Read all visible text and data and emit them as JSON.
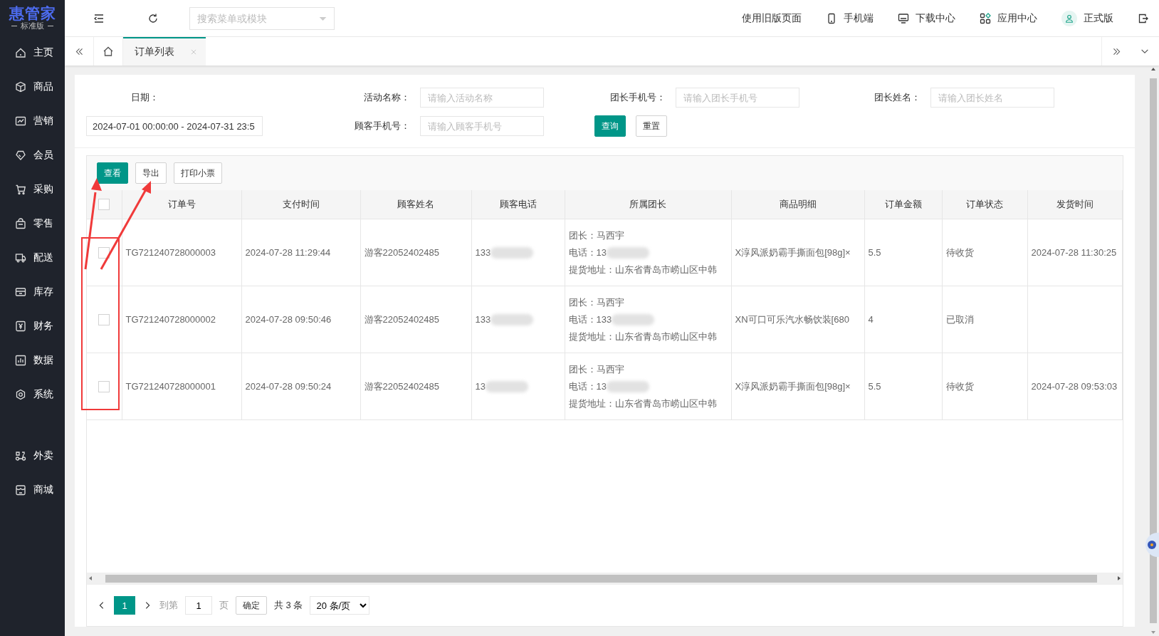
{
  "logo": {
    "title": "惠管家",
    "subtitle": "标准版"
  },
  "sidebar": {
    "items": [
      {
        "label": "主页"
      },
      {
        "label": "商品"
      },
      {
        "label": "营销"
      },
      {
        "label": "会员"
      },
      {
        "label": "采购"
      },
      {
        "label": "零售"
      },
      {
        "label": "配送"
      },
      {
        "label": "库存"
      },
      {
        "label": "财务"
      },
      {
        "label": "数据"
      },
      {
        "label": "系统"
      }
    ],
    "extra_items": [
      {
        "label": "外卖"
      },
      {
        "label": "商城"
      }
    ]
  },
  "topbar": {
    "search": {
      "placeholder": "搜索菜单或模块"
    },
    "links": [
      {
        "label": "使用旧版页面",
        "kind": "text"
      },
      {
        "label": "手机端",
        "kind": "phone"
      },
      {
        "label": "下载中心",
        "kind": "monitor"
      },
      {
        "label": "应用中心",
        "kind": "apps"
      },
      {
        "label": "正式版",
        "kind": "user"
      }
    ]
  },
  "tabs": [
    {
      "label": "订单列表",
      "selected": true
    }
  ],
  "filters": {
    "date_label": "日期：",
    "date_value": "2024-07-01 00:00:00 - 2024-07-31 23:5",
    "fields": [
      {
        "label": "活动名称：",
        "placeholder": "请输入活动名称"
      },
      {
        "label": "团长手机号：",
        "placeholder": "请输入团长手机号"
      },
      {
        "label": "团长姓名：",
        "placeholder": "请输入团长姓名"
      },
      {
        "label": "顾客手机号：",
        "placeholder": "请输入顾客手机号"
      }
    ],
    "query_button": "查询",
    "reset_button": "重置"
  },
  "toolbar": [
    {
      "label": "查看",
      "primary": true
    },
    {
      "label": "导出",
      "primary": false
    },
    {
      "label": "打印小票",
      "primary": false
    }
  ],
  "table": {
    "select_all_checked": false,
    "columns": [
      "订单号",
      "支付时间",
      "顾客姓名",
      "顾客电话",
      "所属团长",
      "商品明细",
      "订单金额",
      "订单状态",
      "发货时间"
    ],
    "rows": [
      {
        "checked": false,
        "order_no": "TG721240728000003",
        "pay_time": "2024-07-28 11:29:44",
        "customer": "游客22052402485",
        "phone": "133",
        "leader": "团长：马西宇",
        "leader_phone": "电话：13",
        "address": "提货地址：山东省青岛市崂山区中韩",
        "goods": "X淳风派奶霸手撕面包[98g]×",
        "amount": "5.5",
        "status": "待收货",
        "ship_time": "2024-07-28 11:30:25"
      },
      {
        "checked": false,
        "order_no": "TG721240728000002",
        "pay_time": "2024-07-28 09:50:46",
        "customer": "游客22052402485",
        "phone": "133",
        "leader": "团长：马西宇",
        "leader_phone": "电话：133",
        "address": "提货地址：山东省青岛市崂山区中韩",
        "goods": "XN可口可乐汽水畅饮装[680",
        "amount": "4",
        "status": "已取消"
      },
      {
        "checked": false,
        "order_no": "TG721240728000001",
        "pay_time": "2024-07-28 09:50:24",
        "customer": "游客22052402485",
        "phone": "13",
        "leader": "团长：马西宇",
        "leader_phone": "电话：13",
        "address": "提货地址：山东省青岛市崂山区中韩",
        "goods": "X淳风派奶霸手撕面包[98g]×",
        "amount": "5.5",
        "status": "待收货",
        "ship_time": "2024-07-28 09:53:03"
      }
    ]
  },
  "pagination": {
    "pages": [
      {
        "label": "1",
        "selected": true
      }
    ],
    "goto_label": "到第",
    "goto_value": "1",
    "page_unit": "页",
    "confirm": "确定",
    "total": "共 3 条",
    "page_size": "20 条/页"
  }
}
